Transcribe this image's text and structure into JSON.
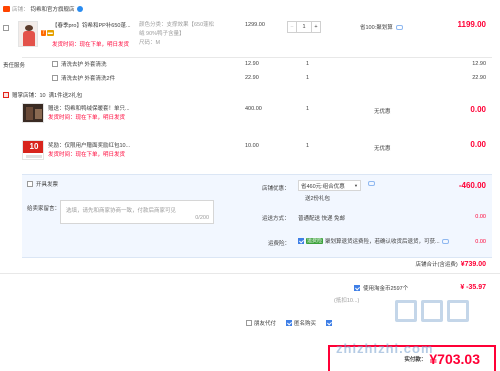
{
  "shop": {
    "label": "店铺：",
    "name": "钧希和官方旗舰店"
  },
  "item1": {
    "title_line1": "【春季pro】钧希和PP补650蓬...",
    "spec_line1": "颜色分类：支撑效果【650蓬松",
    "spec_line2": "绒 90%鸭子含量】",
    "spec_line3": "尺码：M",
    "ship_note": "发货时间：现在下单，明日发货",
    "price": "1299.00",
    "qty": "1",
    "discount": "省100:聚划算",
    "subtotal": "1199.00"
  },
  "services": [
    {
      "title": "责任服务",
      "option": "清洗去护 外套清洗",
      "price": "12.90",
      "qty": "1",
      "subtotal": "12.90"
    },
    {
      "title": "",
      "option": "清洗去护 外套清洗2件",
      "price": "22.90",
      "qty": "1",
      "subtotal": "22.90"
    }
  ],
  "gift_section": {
    "label": "赠掌店铺：10",
    "text": "满1件送2礼包"
  },
  "gift1": {
    "title": "赠送：钧希和鸭绒保暖套！单只...",
    "ship_note": "发货时间：现在下单，明日发货",
    "price": "400.00",
    "qty": "1",
    "delivery": "无优惠",
    "subtotal": "0.00"
  },
  "gift2": {
    "thumb_number": "10",
    "title": "奖励：仅限用户赠面奖励红包10...",
    "ship_note": "发货时间：现在下单，明日发货",
    "price": "10.00",
    "qty": "1",
    "delivery": "无优惠",
    "subtotal": "0.00"
  },
  "invoice": {
    "label": "开具发票"
  },
  "message": {
    "label": "给卖家留言：",
    "placeholder": "选填，请先和商家协商一致，付款后商家可见",
    "count": "0/200"
  },
  "promo": {
    "label": "店铺优惠：",
    "select": "省460元:组合优惠",
    "sub": "送2份礼包",
    "value": "-460.00"
  },
  "shipping": {
    "label": "运送方式：",
    "text": "普通配送 快递 免邮",
    "value": "0.00"
  },
  "insurance": {
    "label": "运费险：",
    "badge": "运费险",
    "text": "聚划算退货运费险，若确认收货后退货，可获...",
    "value": "0.00"
  },
  "store_total": {
    "label": "店铺合计(含运费)",
    "value": "¥739.00"
  },
  "redpacket": {
    "text": "使用淘金币2597个",
    "sub": "(抵扣10...)",
    "value": "¥ -35.97"
  },
  "options": {
    "anon": "匿名购买",
    "pay_other": "朋友代付"
  },
  "grand": {
    "label": "实付款：",
    "value": "¥703.03"
  },
  "watermark": "zhizhizhi.com"
}
